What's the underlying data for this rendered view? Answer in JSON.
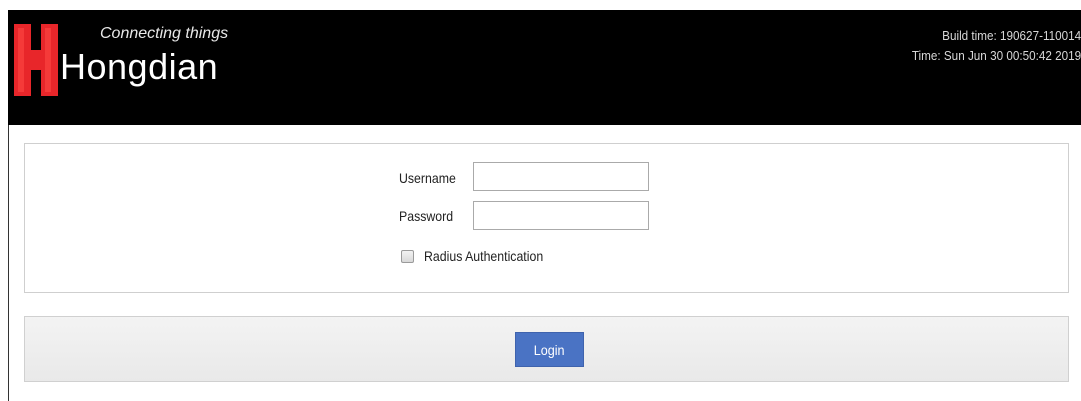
{
  "header": {
    "brand": "Hongdian",
    "tagline": "Connecting things",
    "build_time": "Build time: 190627-110014",
    "current_time": "Time: Sun Jun 30 00:50:42 2019"
  },
  "login_form": {
    "username_label": "Username",
    "username_value": "",
    "password_label": "Password",
    "password_value": "",
    "radius_label": "Radius Authentication",
    "radius_checked": false,
    "login_button": "Login"
  },
  "colors": {
    "header_bg": "#000000",
    "logo_red": "#e8262a",
    "button_blue": "#4a73c4"
  },
  "icons": {
    "logo": "hongdian-logo-icon"
  }
}
